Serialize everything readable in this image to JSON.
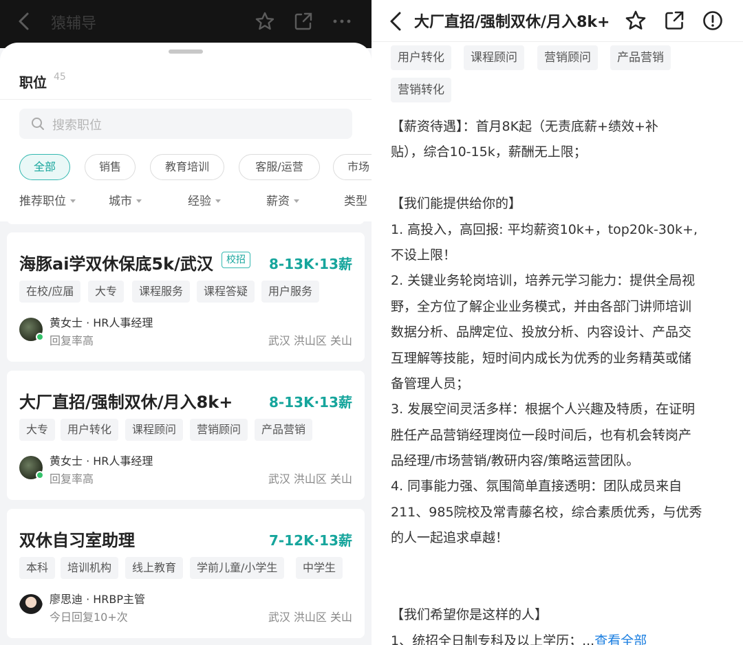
{
  "left": {
    "topbar": {
      "title": "猿辅导"
    },
    "sheet": {
      "title": "职位",
      "count": "45",
      "search_placeholder": "搜索职位",
      "chips": [
        "全部",
        "销售",
        "教育培训",
        "客服/运营",
        "市场"
      ],
      "filters": [
        "推荐职位",
        "城市",
        "经验",
        "薪资",
        "类型"
      ]
    },
    "jobs": [
      {
        "title": "海豚ai学双休保底5k/武汉",
        "badge": "校招",
        "salary": "8-13K·13薪",
        "tags": [
          "在校/应届",
          "大专",
          "课程服务",
          "课程答疑",
          "用户服务"
        ],
        "recruiter": "黄女士 · HR人事经理",
        "reply": "回复率高",
        "location": "武汉 洪山区 关山"
      },
      {
        "title": "大厂直招/强制双休/月入8k+",
        "badge": "",
        "salary": "8-13K·13薪",
        "tags": [
          "大专",
          "用户转化",
          "课程顾问",
          "营销顾问",
          "产品营销"
        ],
        "recruiter": "黄女士 · HR人事经理",
        "reply": "回复率高",
        "location": "武汉 洪山区 关山"
      },
      {
        "title": "双休自习室助理",
        "badge": "",
        "salary": "7-12K·13薪",
        "tags": [
          "本科",
          "培训机构",
          "线上教育",
          "学前儿童/小学生",
          "中学生"
        ],
        "recruiter": "廖思迪 · HRBP主管",
        "reply": "今日回复10+次",
        "location": "武汉 洪山区 关山"
      }
    ]
  },
  "right": {
    "title": "大厂直招/强制双休/月入8k+",
    "tags": [
      "用户转化",
      "课程顾问",
      "营销顾问",
      "产品营销",
      "营销转化"
    ],
    "lines": [
      "【薪资待遇】：首月8K起（无责底薪+绩效+补",
      "贴），综合10-15k，薪酬无上限；",
      "",
      "【我们能提供给你的】",
      "1. 高投入，高回报: 平均薪资10k+，top20k-30k+,",
      "不设上限！",
      "2. 关键业务轮岗培训，培养元学习能力：提供全局视",
      "野，全方位了解企业业务模式，并由各部门讲师培训",
      "数据分析、品牌定位、投放分析、内容设计、产品交",
      "互理解等技能，短时间内成长为优秀的业务精英或储",
      "备管理人员；",
      "3. 发展空间灵活多样：根据个人兴趣及特质，在证明",
      "胜任产品营销经理岗位一段时间后，也有机会转岗产",
      "品经理/市场营销/教研内容/策略运营团队。",
      "4. 同事能力强、氛围简单直接透明：团队成员来自",
      "211、985院校及常青藤名校，综合素质优秀，与优秀",
      "的人一起追求卓越！",
      "",
      "",
      "【我们希望你是这样的人】"
    ],
    "last_line": "1、统招全日制专科及以上学历；",
    "more_prefix": "...",
    "more_link": "查看全部"
  }
}
